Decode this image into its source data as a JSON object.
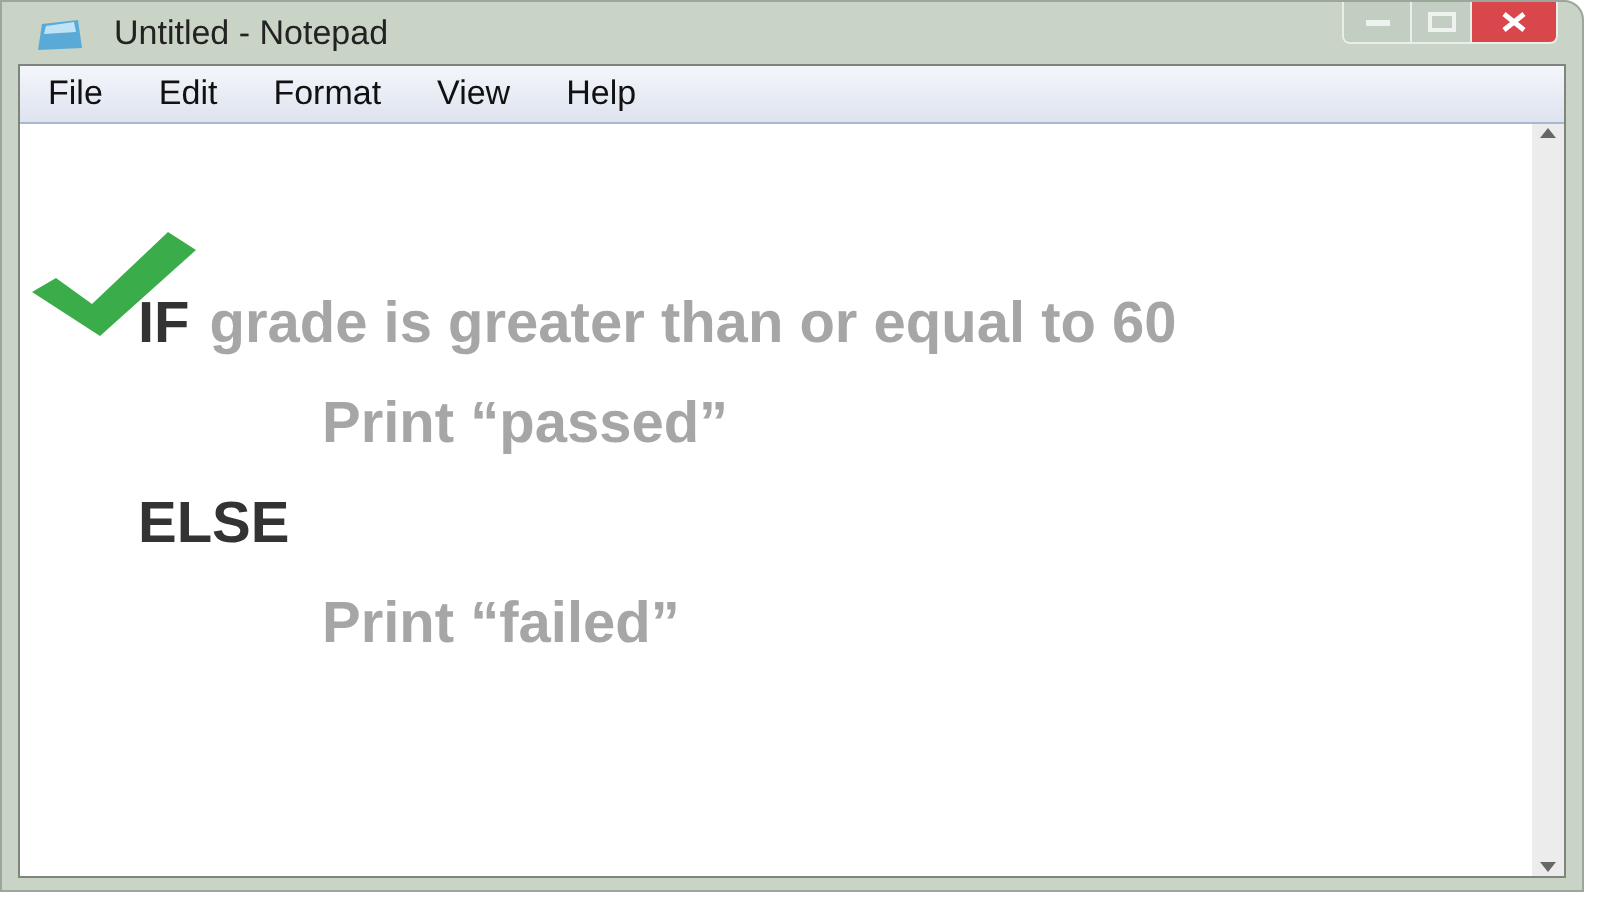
{
  "window": {
    "title": "Untitled - Notepad"
  },
  "menu": [
    "File",
    "Edit",
    "Format",
    "View",
    "Help"
  ],
  "lines": [
    {
      "keyword": "IF",
      "text": "grade is greater than or equal to 60",
      "checked": true,
      "children": [
        {
          "text": "Print “passed”"
        }
      ]
    },
    {
      "keyword": "ELSE",
      "checked": false,
      "children": [
        {
          "text": "Print “failed”"
        }
      ]
    }
  ]
}
